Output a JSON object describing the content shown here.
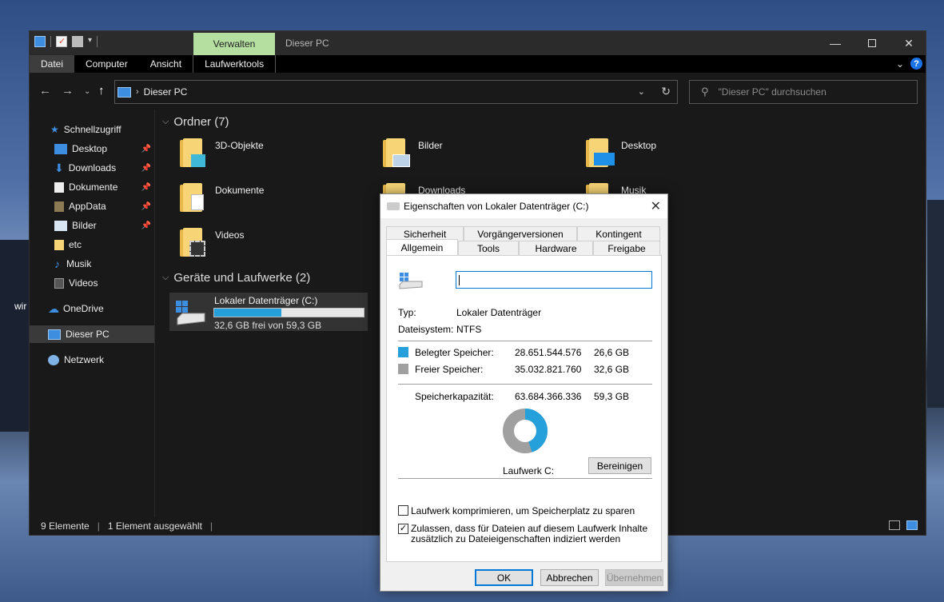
{
  "desktop": {
    "partial_text": "wir"
  },
  "window": {
    "title": "Dieser PC",
    "context_tab": "Verwalten",
    "ribbon_tabs": [
      "Datei",
      "Computer",
      "Ansicht",
      "Laufwerktools"
    ]
  },
  "addressbar": {
    "path": "Dieser PC",
    "search_placeholder": "\"Dieser PC\" durchsuchen"
  },
  "sidebar": {
    "quick_access": "Schnellzugriff",
    "items": [
      {
        "label": "Desktop",
        "pinned": true
      },
      {
        "label": "Downloads",
        "pinned": true
      },
      {
        "label": "Dokumente",
        "pinned": true
      },
      {
        "label": "AppData",
        "pinned": true
      },
      {
        "label": "Bilder",
        "pinned": true
      },
      {
        "label": "etc",
        "pinned": false
      },
      {
        "label": "Musik",
        "pinned": false
      },
      {
        "label": "Videos",
        "pinned": false
      }
    ],
    "onedrive": "OneDrive",
    "this_pc": "Dieser PC",
    "network": "Netzwerk"
  },
  "content": {
    "folders_header": "Ordner (7)",
    "folders": [
      "3D-Objekte",
      "Bilder",
      "Desktop",
      "Dokumente",
      "Downloads",
      "Musik",
      "Videos"
    ],
    "drives_header": "Geräte und Laufwerke (2)",
    "drive": {
      "name": "Lokaler Datenträger (C:)",
      "free_text": "32,6 GB frei von 59,3 GB",
      "used_fraction": 0.45
    }
  },
  "statusbar": {
    "count": "9 Elemente",
    "selected": "1 Element ausgewählt"
  },
  "dialog": {
    "title": "Eigenschaften von Lokaler Datenträger (C:)",
    "tabs_row1": [
      "Sicherheit",
      "Vorgängerversionen",
      "Kontingent"
    ],
    "tabs_row2": [
      "Allgemein",
      "Tools",
      "Hardware",
      "Freigabe"
    ],
    "name_value": "",
    "type_label": "Typ:",
    "type_value": "Lokaler Datenträger",
    "fs_label": "Dateisystem:",
    "fs_value": "NTFS",
    "used_label": "Belegter Speicher:",
    "used_bytes": "28.651.544.576",
    "used_gb": "26,6 GB",
    "free_label": "Freier Speicher:",
    "free_bytes": "35.032.821.760",
    "free_gb": "32,6 GB",
    "cap_label": "Speicherkapazität:",
    "cap_bytes": "63.684.366.336",
    "cap_gb": "59,3 GB",
    "drive_label": "Laufwerk C:",
    "cleanup_button": "Bereinigen",
    "compress_label": "Laufwerk komprimieren, um Speicherplatz zu sparen",
    "compress_checked": false,
    "index_label_1": "Zulassen, dass für Dateien auf diesem Laufwerk Inhalte",
    "index_label_2": "zusätzlich zu Dateieigenschaften indiziert werden",
    "index_checked": true,
    "ok": "OK",
    "cancel": "Abbrechen",
    "apply": "Übernehmen",
    "used_fraction": 0.45,
    "colors": {
      "used": "#26a0da",
      "free": "#a0a0a0"
    }
  }
}
